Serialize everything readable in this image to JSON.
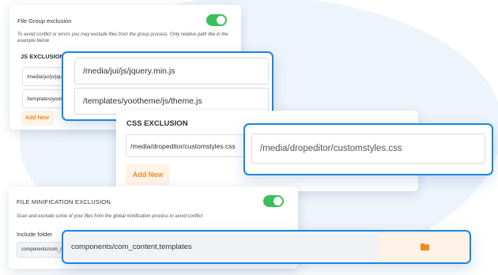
{
  "file_group": {
    "title": "File Group exclusion",
    "toggle_on": true,
    "hint": "To avoid conflict or errors you may exclude files from the group process. Only relative path like in the example below",
    "js_heading": "JS EXCLUSION",
    "js_items": [
      "/media/jui/js/jquery.min.js",
      "/templates/yootheme/js/theme.js"
    ],
    "add_new": "Add New"
  },
  "js_focus": {
    "items": [
      "/media/jui/js/jquery.min.js",
      "/templates/yootheme/js/theme.js"
    ]
  },
  "css_card": {
    "heading": "CSS EXCLUSION",
    "item": "/media/dropeditor/customstyles.css",
    "add_new": "Add New"
  },
  "css_focus": {
    "item": "/media/dropeditor/customstyles.css"
  },
  "minification": {
    "title": "FILE MINIFICATION EXCLUSION",
    "toggle_on": true,
    "hint": "Scan and exclude some of your files from the global minification process to avoid conflict",
    "include_label": "Include folder",
    "folder_value": "components/com_content,templates"
  },
  "folder_focus": {
    "value": "components/com_content,templates",
    "icon": "folder-icon"
  },
  "colors": {
    "accent_blue": "#1a86e0",
    "toggle_green": "#3cbf5a",
    "add_orange": "#f08a24"
  }
}
